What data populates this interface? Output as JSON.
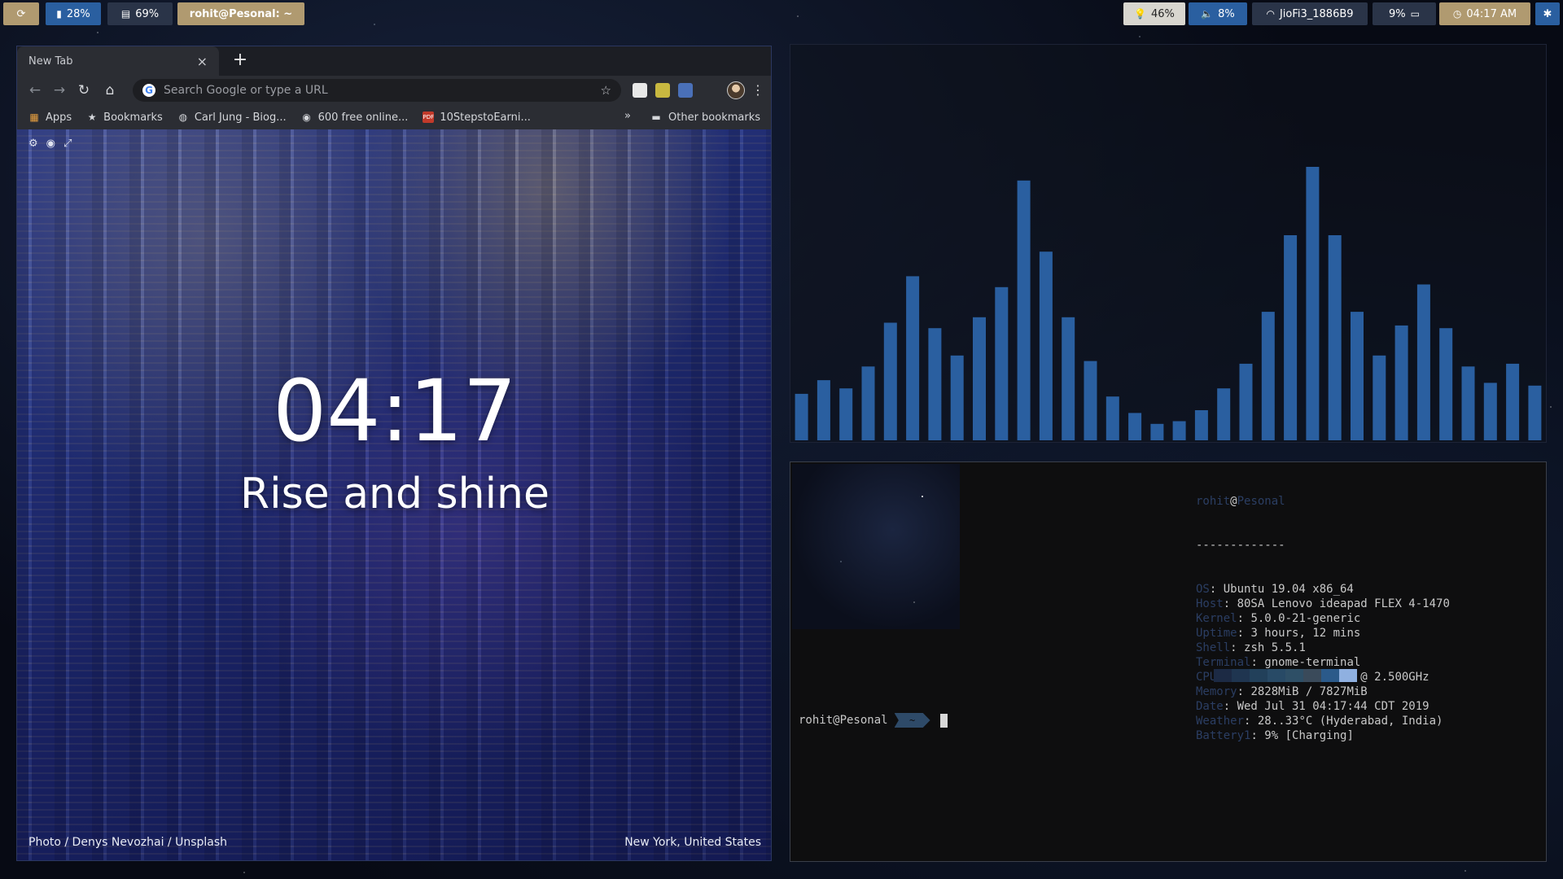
{
  "topbar": {
    "ws_icon": "refresh-icon",
    "cpu": "28%",
    "mem": "69%",
    "window_title": "rohit@Pesonal: ~",
    "brightness": "46%",
    "volume": "8%",
    "wifi": "JioFi3_1886B9",
    "battery": "9%",
    "clock": "04:17 AM"
  },
  "colors": {
    "bar_blue": "#2a5fa0",
    "bar_tan": "#b09a70",
    "bar_light": "#d8d6cf",
    "accent_term": "#2b3e63"
  },
  "browser": {
    "tab_title": "New Tab",
    "new_tab": "+",
    "omnibox_placeholder": "Search Google or type a URL",
    "bookmarks": [
      {
        "label": "Apps",
        "icon": "apps-grid-icon"
      },
      {
        "label": "Bookmarks",
        "icon": "star-icon"
      },
      {
        "label": "Carl Jung - Biog...",
        "icon": "globe-icon"
      },
      {
        "label": "600 free online...",
        "icon": "q-logo-icon"
      },
      {
        "label": "10StepstoEarni...",
        "icon": "pdf-icon"
      }
    ],
    "more": "»",
    "other_bookmarks": "Other bookmarks"
  },
  "ntp": {
    "time": "04:17",
    "greeting": "Rise and shine",
    "credit": "Photo / Denys Nevozhai / Unsplash",
    "location": "New York, United States"
  },
  "visualizer": {
    "levels": [
      0.17,
      0.22,
      0.19,
      0.27,
      0.43,
      0.6,
      0.41,
      0.31,
      0.45,
      0.56,
      0.95,
      0.69,
      0.45,
      0.29,
      0.16,
      0.1,
      0.06,
      0.07,
      0.11,
      0.19,
      0.28,
      0.47,
      0.75,
      1.0,
      0.75,
      0.47,
      0.31,
      0.42,
      0.57,
      0.41,
      0.27,
      0.21,
      0.28,
      0.2
    ],
    "color": "#2a5fa0"
  },
  "terminal": {
    "user": "rohit",
    "at": "@",
    "host": "Pesonal",
    "separator": "-------------",
    "info": [
      {
        "key": "OS",
        "value": "Ubuntu 19.04 x86_64"
      },
      {
        "key": "Host",
        "value": "80SA Lenovo ideapad FLEX 4-1470"
      },
      {
        "key": "Kernel",
        "value": "5.0.0-21-generic"
      },
      {
        "key": "Uptime",
        "value": "3 hours, 12 mins"
      },
      {
        "key": "Shell",
        "value": "zsh 5.5.1"
      },
      {
        "key": "Terminal",
        "value": "gnome-terminal"
      },
      {
        "key": "CPU",
        "value": "Intel i7-6500U (4) @ 2.500GHz"
      },
      {
        "key": "Memory",
        "value": "2828MiB / 7827MiB"
      },
      {
        "key": "Date",
        "value": "Wed Jul 31 04:17:44 CDT 2019"
      },
      {
        "key": "Weather",
        "value": "28..33°C (Hyderabad, India)"
      },
      {
        "key": "Battery1",
        "value": "9% [Charging]"
      }
    ],
    "swatches": [
      "#1c2a44",
      "#1f3550",
      "#22405a",
      "#284a66",
      "#2e4f66",
      "#3a4a5a",
      "#2b5a8a",
      "#8fb0e0"
    ],
    "prompt_host": "rohit@Pesonal",
    "prompt_dir": "~"
  }
}
